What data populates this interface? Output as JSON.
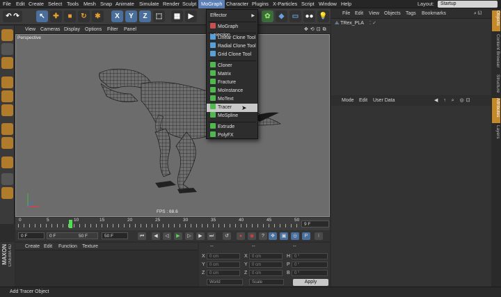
{
  "menubar": {
    "items": [
      "File",
      "Edit",
      "Create",
      "Select",
      "Tools",
      "Mesh",
      "Snap",
      "Animate",
      "Simulate",
      "Render",
      "Sculpt",
      "MoGraph",
      "Character",
      "Plugins",
      "X-Particles",
      "Script",
      "Window",
      "Help"
    ],
    "active": "MoGraph",
    "layout_label": "Layout:",
    "layout_value": "Startup"
  },
  "dropdown": {
    "items": [
      {
        "label": "Effector",
        "submenu": true,
        "icon": ""
      },
      {
        "label": "MoGraph Selection",
        "icon": "mograph-selection-icon"
      },
      {
        "label": "Linear Clone Tool",
        "icon": "linear-clone-icon"
      },
      {
        "label": "Radial Clone Tool",
        "icon": "radial-clone-icon"
      },
      {
        "label": "Grid Clone Tool",
        "icon": "grid-clone-icon"
      },
      {
        "label": "Cloner",
        "icon": "cloner-icon"
      },
      {
        "label": "Matrix",
        "icon": "matrix-icon"
      },
      {
        "label": "Fracture",
        "icon": "fracture-icon"
      },
      {
        "label": "MoInstance",
        "icon": "moinstance-icon"
      },
      {
        "label": "MoText",
        "icon": "motext-icon"
      },
      {
        "label": "Tracer",
        "icon": "tracer-icon",
        "highlighted": true
      },
      {
        "label": "MoSpline",
        "icon": "mospline-icon"
      },
      {
        "label": "Extrude",
        "icon": "extrude-icon"
      },
      {
        "label": "PolyFX",
        "icon": "polyfx-icon"
      }
    ]
  },
  "viewport": {
    "menu": [
      "View",
      "Cameras",
      "Display",
      "Options",
      "Filter",
      "Panel"
    ],
    "label": "Perspective",
    "fps": "FPS : 68.6"
  },
  "timeline": {
    "ticks": [
      "0",
      "5",
      "10",
      "15",
      "20",
      "25",
      "30",
      "35",
      "40",
      "45",
      "50"
    ],
    "current_frame_marker": "10",
    "end_field": "9 F"
  },
  "transport": {
    "start": "0 F",
    "min": "0 F",
    "max": "50 F",
    "end": "50 F"
  },
  "materials": {
    "menu": [
      "Create",
      "Edit",
      "Function",
      "Texture"
    ]
  },
  "coords": {
    "header": [
      "--",
      "--",
      "--"
    ],
    "rows": [
      {
        "a": "X",
        "av": "0 cm",
        "b": "X",
        "bv": "0 cm",
        "c": "H",
        "cv": "0 °"
      },
      {
        "a": "Y",
        "av": "0 cm",
        "b": "Y",
        "bv": "0 cm",
        "c": "P",
        "cv": "0 °"
      },
      {
        "a": "Z",
        "av": "0 cm",
        "b": "Z",
        "bv": "0 cm",
        "c": "B",
        "cv": "0 °"
      }
    ],
    "world": "World",
    "scale": "Scale",
    "apply": "Apply"
  },
  "objects": {
    "menu": [
      "File",
      "Edit",
      "View",
      "Objects",
      "Tags",
      "Bookmarks"
    ],
    "item": "TRex_PLA"
  },
  "attributes": {
    "menu": [
      "Mode",
      "Edit",
      "User Data"
    ]
  },
  "right_tabs": [
    "Objects",
    "Content Browser",
    "Structure",
    "Attributes",
    "Layers"
  ],
  "brand": [
    "MAXON",
    "CINEMA 4D"
  ],
  "status": "Add Tracer Object",
  "colors": {
    "accent": "#5b7fb6",
    "orange": "#c6892a"
  }
}
